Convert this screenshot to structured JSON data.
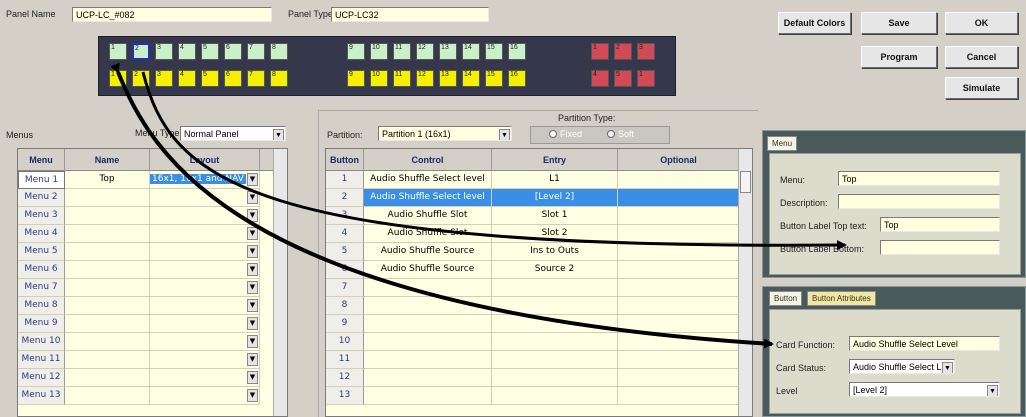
{
  "header": {
    "panel_name_label": "Panel Name",
    "panel_name_value": "UCP-LC_#082",
    "panel_type_label": "Panel Type",
    "panel_type_value": "UCP-LC32"
  },
  "buttons": {
    "default_colors": "Default Colors",
    "save": "Save",
    "ok": "OK",
    "program": "Program",
    "cancel": "Cancel",
    "simulate": "Simulate"
  },
  "keys": {
    "top_row": [
      "1",
      "2",
      "3",
      "4",
      "5",
      "6",
      "7",
      "8",
      "9",
      "10",
      "11",
      "12",
      "13",
      "14",
      "15",
      "16",
      "1",
      "2",
      "3"
    ],
    "bottom_row": [
      "1",
      "2",
      "3",
      "4",
      "5",
      "6",
      "7",
      "8",
      "9",
      "10",
      "11",
      "12",
      "13",
      "14",
      "15",
      "16",
      "4",
      "5",
      "1"
    ]
  },
  "menus_section": {
    "label": "Menus",
    "menu_type_label": "Menu Type:",
    "menu_type_value": "Normal Panel",
    "columns": [
      "Menu",
      "Name",
      "Layout"
    ],
    "rows": [
      {
        "menu": "Menu 1",
        "name": "Top",
        "layout": "16x1, 16x1 and NAV"
      },
      {
        "menu": "Menu 2",
        "name": "",
        "layout": ""
      },
      {
        "menu": "Menu 3",
        "name": "",
        "layout": ""
      },
      {
        "menu": "Menu 4",
        "name": "",
        "layout": ""
      },
      {
        "menu": "Menu 5",
        "name": "",
        "layout": ""
      },
      {
        "menu": "Menu 6",
        "name": "",
        "layout": ""
      },
      {
        "menu": "Menu 7",
        "name": "",
        "layout": ""
      },
      {
        "menu": "Menu 8",
        "name": "",
        "layout": ""
      },
      {
        "menu": "Menu 9",
        "name": "",
        "layout": ""
      },
      {
        "menu": "Menu 10",
        "name": "",
        "layout": ""
      },
      {
        "menu": "Menu 11",
        "name": "",
        "layout": ""
      },
      {
        "menu": "Menu 12",
        "name": "",
        "layout": ""
      },
      {
        "menu": "Menu 13",
        "name": "",
        "layout": ""
      }
    ]
  },
  "partition_section": {
    "partition_label": "Partition:",
    "partition_value": "Partition 1 (16x1)",
    "partition_type_label": "Partition Type:",
    "fixed_label": "Fixed",
    "soft_label": "Soft",
    "columns": [
      "Button",
      "Control",
      "Entry",
      "Optional"
    ],
    "rows": [
      {
        "button": "1",
        "control": "Audio Shuffle Select level",
        "entry": "L1",
        "optional": ""
      },
      {
        "button": "2",
        "control": "Audio Shuffle Select level",
        "entry": "[Level 2]",
        "optional": ""
      },
      {
        "button": "3",
        "control": "Audio Shuffle Slot",
        "entry": "Slot 1",
        "optional": ""
      },
      {
        "button": "4",
        "control": "Audio Shuffle Slot",
        "entry": "Slot 2",
        "optional": ""
      },
      {
        "button": "5",
        "control": "Audio Shuffle Source",
        "entry": "Ins to Outs",
        "optional": ""
      },
      {
        "button": "6",
        "control": "Audio Shuffle Source",
        "entry": "Source 2",
        "optional": ""
      },
      {
        "button": "7",
        "control": "",
        "entry": "",
        "optional": ""
      },
      {
        "button": "8",
        "control": "",
        "entry": "",
        "optional": ""
      },
      {
        "button": "9",
        "control": "",
        "entry": "",
        "optional": ""
      },
      {
        "button": "10",
        "control": "",
        "entry": "",
        "optional": ""
      },
      {
        "button": "11",
        "control": "",
        "entry": "",
        "optional": ""
      },
      {
        "button": "12",
        "control": "",
        "entry": "",
        "optional": ""
      },
      {
        "button": "13",
        "control": "",
        "entry": "",
        "optional": ""
      }
    ]
  },
  "menu_tab": {
    "tab_label": "Menu",
    "menu_label": "Menu:",
    "menu_value": "Top",
    "description_label": "Description:",
    "description_value": "",
    "top_text_label": "Button Label Top text:",
    "top_text_value": "Top",
    "bottom_label": "Button Label Bottom:",
    "bottom_value": ""
  },
  "button_tab": {
    "tab_button": "Button",
    "tab_attributes": "Button Attributes",
    "function_label": "Card Function:",
    "function_value": "Audio Shuffle Select Level",
    "status_label": "Card Status:",
    "status_value": "Audio Shuffle Select L",
    "level_label": "Level",
    "level_value": "[Level 2]"
  },
  "colors": {
    "background": "#d4d0c8",
    "grid": "#ffffe4",
    "selection": "#3a8ee6",
    "key_green": "#c9f0c9",
    "key_yellow": "#f4f000",
    "key_red": "#d24a55"
  }
}
